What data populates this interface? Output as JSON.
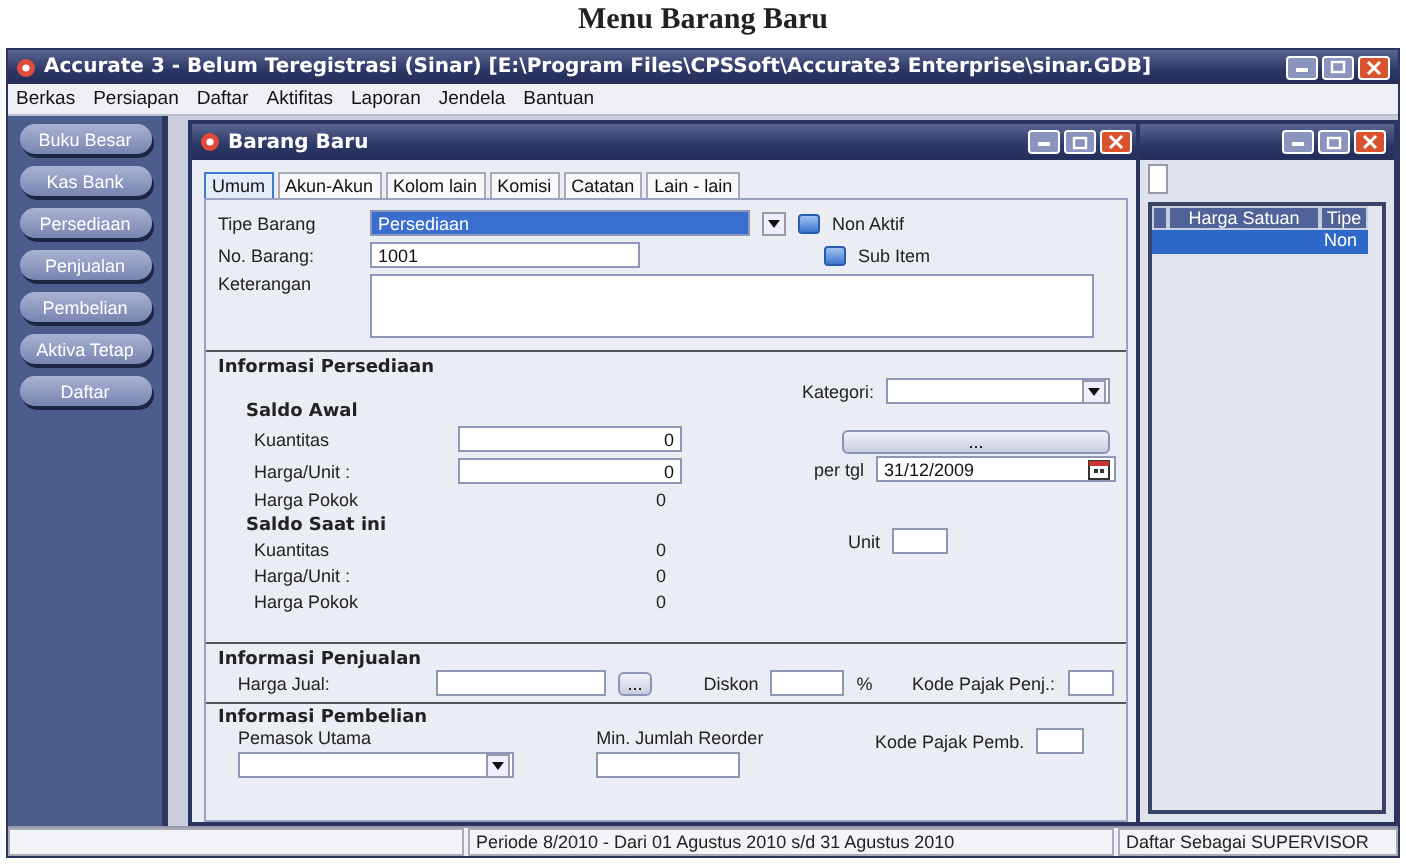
{
  "caption": "Menu Barang Baru",
  "window": {
    "title": "Accurate 3  - Belum Teregistrasi (Sinar)  [E:\\Program Files\\CPSSoft\\Accurate3 Enterprise\\sinar.GDB]"
  },
  "menu": [
    "Berkas",
    "Persiapan",
    "Daftar",
    "Aktifitas",
    "Laporan",
    "Jendela",
    "Bantuan"
  ],
  "sidebar": {
    "items": [
      "Buku Besar",
      "Kas Bank",
      "Persediaan",
      "Penjualan",
      "Pembelian",
      "Aktiva Tetap",
      "Daftar"
    ]
  },
  "form": {
    "title": "Barang Baru",
    "tabs": [
      {
        "label": "Umum",
        "selected": true
      },
      {
        "label": "Akun-Akun",
        "selected": false
      },
      {
        "label": "Kolom lain",
        "selected": false
      },
      {
        "label": "Komisi",
        "selected": false
      },
      {
        "label": "Catatan",
        "selected": false
      },
      {
        "label": "Lain - lain",
        "selected": false
      }
    ],
    "tipe_barang": {
      "label": "Tipe Barang",
      "value": "Persediaan"
    },
    "non_aktif": {
      "label": "Non Aktif",
      "checked": false
    },
    "no_barang": {
      "label": "No. Barang:",
      "value": "1001"
    },
    "sub_item": {
      "label": "Sub Item",
      "checked": false
    },
    "keterangan": {
      "label": "Keterangan"
    },
    "persediaan": {
      "title": "Informasi Persediaan",
      "kategori_label": "Kategori:",
      "button": "...",
      "per_tgl_label": "per tgl",
      "per_tgl": "31/12/2009",
      "unit_label": "Unit",
      "saldo_awal": {
        "title": "Saldo Awal",
        "kuantitas_label": "Kuantitas",
        "kuantitas": "0",
        "harga_unit_label": "Harga/Unit :",
        "harga_unit": "0",
        "harga_pokok_label": "Harga Pokok",
        "harga_pokok": "0"
      },
      "saldo_saat_ini": {
        "title": "Saldo Saat ini",
        "kuantitas_label": "Kuantitas",
        "kuantitas": "0",
        "harga_unit_label": "Harga/Unit :",
        "harga_unit": "0",
        "harga_pokok_label": "Harga Pokok",
        "harga_pokok": "0"
      }
    },
    "penjualan": {
      "title": "Informasi Penjualan",
      "harga_jual_label": "Harga Jual:",
      "button": "...",
      "diskon_label": "Diskon",
      "percent": "%",
      "pajak_label": "Kode Pajak Penj.:"
    },
    "pembelian": {
      "title": "Informasi Pembelian",
      "pemasok_label": "Pemasok Utama",
      "reorder_label": "Min. Jumlah Reorder",
      "pajak_label": "Kode Pajak Pemb."
    }
  },
  "list_window": {
    "columns": [
      "Harga Satuan",
      "Tipe"
    ],
    "rows": [
      {
        "tipe": "Non",
        "selected": true
      }
    ]
  },
  "status_bar": {
    "period": "Periode 8/2010 - Dari 01 Agustus 2010 s/d 31 Agustus 2010",
    "user": "Daftar Sebagai SUPERVISOR"
  }
}
